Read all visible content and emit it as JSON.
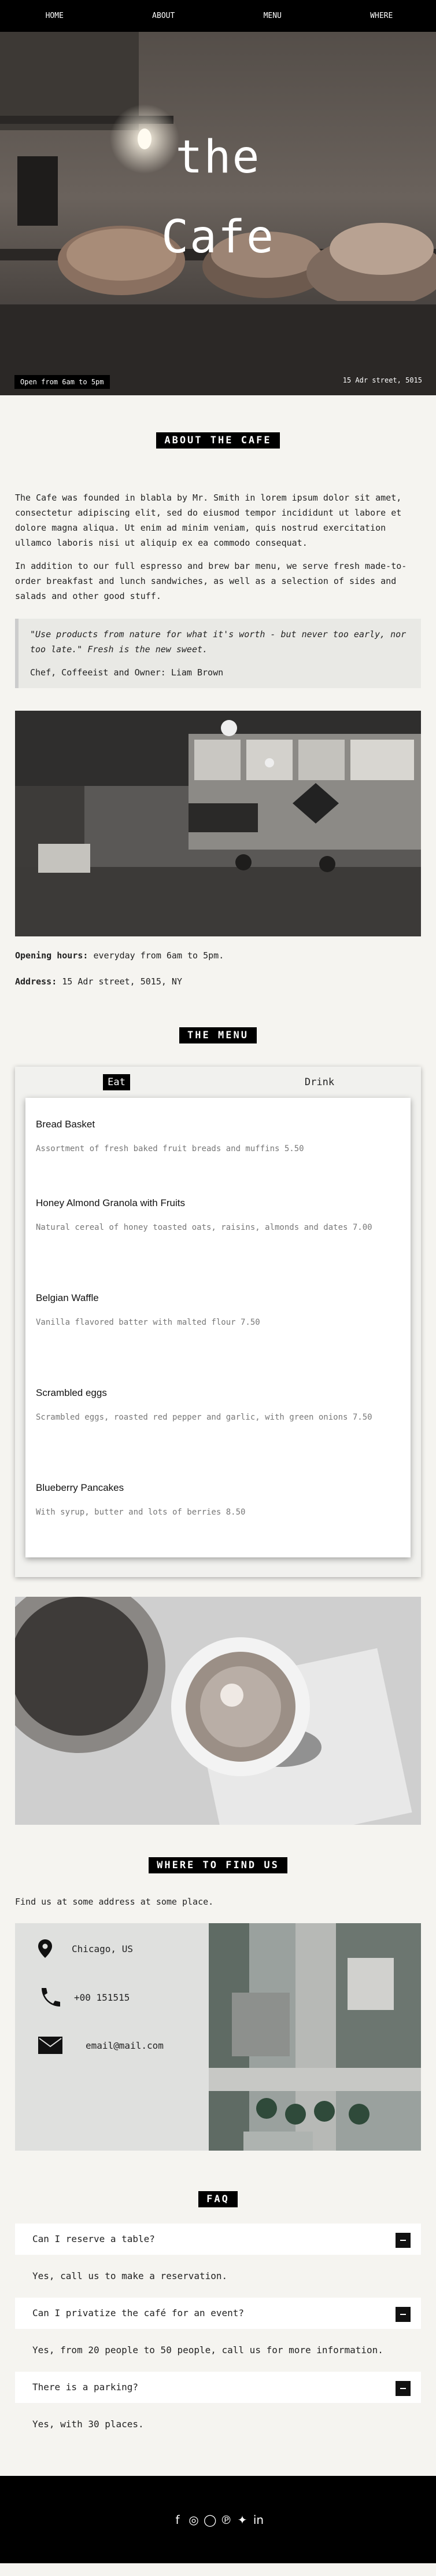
{
  "nav": [
    "HOME",
    "ABOUT",
    "MENU",
    "WHERE"
  ],
  "hero": {
    "title_line1": "the",
    "title_line2": "Cafe",
    "open_badge": "Open from 6am to 5pm",
    "address": "15 Adr street, 5015"
  },
  "about": {
    "title": "ABOUT THE CAFE",
    "p1": "The Cafe was founded in blabla by Mr. Smith in lorem ipsum dolor sit amet, consectetur adipiscing elit, sed do eiusmod tempor incididunt ut labore et dolore magna aliqua. Ut enim ad minim veniam, quis nostrud exercitation ullamco laboris nisi ut aliquip ex ea commodo consequat.",
    "p2": "In addition to our full espresso and brew bar menu, we serve fresh made-to-order breakfast and lunch sandwiches, as well as a selection of sides and salads and other good stuff.",
    "quote": "\"Use products from nature for what it's worth - but never too early, nor too late.\" Fresh is the new sweet.",
    "signature": "Chef, Coffeeist and Owner: Liam Brown"
  },
  "info": {
    "hours_label": "Opening hours:",
    "hours_value": " everyday from 6am to 5pm.",
    "address_label": "Address:",
    "address_value": " 15 Adr street, 5015, NY"
  },
  "menu": {
    "title": "THE MENU",
    "tabs": [
      "Eat",
      "Drink"
    ],
    "items": [
      {
        "name": "Bread Basket",
        "desc": "Assortment of fresh baked fruit breads and muffins 5.50"
      },
      {
        "name": "Honey Almond Granola with Fruits",
        "desc": "Natural cereal of honey toasted oats, raisins, almonds and dates 7.00"
      },
      {
        "name": "Belgian Waffle",
        "desc": "Vanilla flavored batter with malted flour 7.50"
      },
      {
        "name": "Scrambled eggs",
        "desc": "Scrambled eggs, roasted red pepper and garlic, with green onions 7.50"
      },
      {
        "name": "Blueberry Pancakes",
        "desc": "With syrup, butter and lots of berries 8.50"
      }
    ]
  },
  "find": {
    "title": "WHERE TO FIND US",
    "intro": "Find us at some address at some place.",
    "location": "Chicago, US",
    "phone": "+00 151515",
    "email": "email@mail.com"
  },
  "faq": {
    "title": "FAQ",
    "items": [
      {
        "q": "Can I reserve a table?",
        "a": "Yes, call us to make a reservation."
      },
      {
        "q": "Can I privatize the café for an event?",
        "a": "Yes, from 20 people to 50 people, call us for more information."
      },
      {
        "q": "There is a parking?",
        "a": "Yes, with 30 places."
      }
    ]
  },
  "footer": {
    "icons": [
      "facebook-icon",
      "instagram-icon",
      "snapchat-icon",
      "pinterest-icon",
      "twitter-icon",
      "linkedin-icon"
    ],
    "glyphs": [
      "f",
      "◎",
      "◯",
      "℗",
      "✦",
      "in"
    ]
  },
  "colors": {
    "dark": "#000000",
    "background": "#f5f4f0",
    "panel": "#ffffff"
  }
}
